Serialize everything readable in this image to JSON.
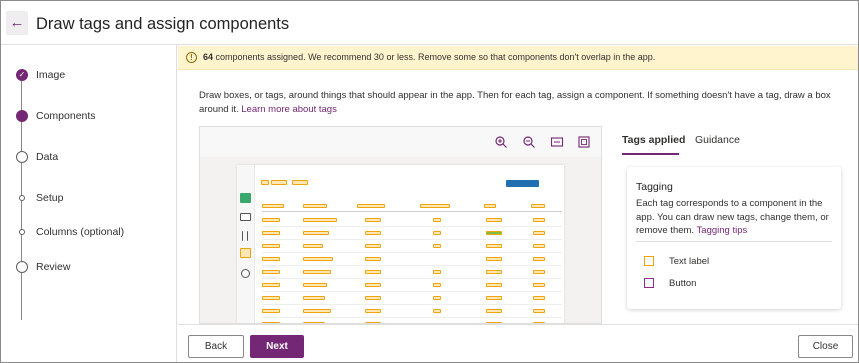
{
  "window": {
    "title": "Draw tags and assign components"
  },
  "steps": [
    {
      "label": "Image",
      "state": "done"
    },
    {
      "label": "Components",
      "state": "current"
    },
    {
      "label": "Data",
      "state": "pending"
    },
    {
      "label": "Setup",
      "state": "substep"
    },
    {
      "label": "Columns (optional)",
      "state": "substep"
    },
    {
      "label": "Review",
      "state": "pending"
    }
  ],
  "banner": {
    "count": "64",
    "text": " components assigned. We recommend 30 or less. Remove some so that components don't overlap in the app."
  },
  "intro": {
    "text": "Draw boxes, or tags, around things that should appear in the app. Then for each tag, assign a component. If something doesn't have a tag, draw a box around it. ",
    "link": "Learn more about tags"
  },
  "toolbar_icons": [
    "zoom-in-icon",
    "zoom-out-icon",
    "fit-width-icon",
    "fit-screen-icon"
  ],
  "right_panel": {
    "tabs": [
      "Tags applied",
      "Guidance"
    ],
    "active_tab": "Tags applied",
    "card": {
      "title": "Tagging",
      "body": "Each tag corresponds to a component in the app. You can draw new tags, change them, or remove them. ",
      "link": "Tagging tips",
      "legend": [
        {
          "label": "Text label",
          "color": "#f0a30a"
        },
        {
          "label": "Button",
          "color": "#8e2b8e"
        }
      ]
    }
  },
  "footer": {
    "back": "Back",
    "next": "Next",
    "close": "Close"
  },
  "colors": {
    "accent": "#742774",
    "tag": "#f0a30a",
    "banner_bg": "#fff4ce"
  }
}
